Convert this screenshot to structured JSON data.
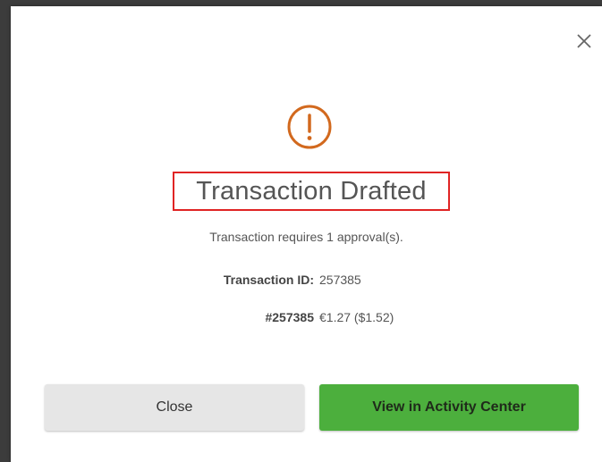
{
  "dialog": {
    "title": "Transaction Drafted",
    "subtitle": "Transaction requires 1 approval(s).",
    "icon": "exclamation-circle-icon",
    "icon_color": "#d2691e",
    "close_icon": "close-icon"
  },
  "details": {
    "transaction_id_label": "Transaction ID:",
    "transaction_id_value": "257385",
    "reference_label": "#257385",
    "reference_value": "€1.27 ($1.52)"
  },
  "buttons": {
    "close_label": "Close",
    "view_label": "View in Activity Center",
    "view_color": "#4caf3d"
  },
  "highlight": {
    "border_color": "#e02424"
  }
}
